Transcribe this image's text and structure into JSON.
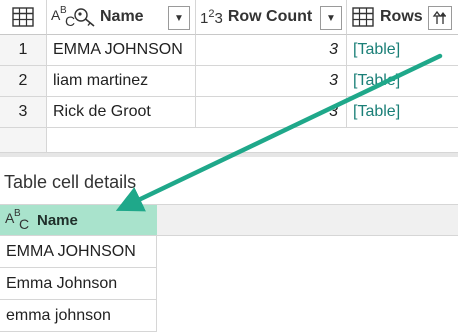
{
  "grid": {
    "columns": [
      {
        "name": "Name",
        "type_icon": "text-type-icon",
        "type_label": "ABC"
      },
      {
        "name": "Row Count",
        "type_icon": "number-type-icon",
        "type_label": "123"
      },
      {
        "name": "Rows",
        "type_icon": "table-type-icon"
      }
    ],
    "rows": [
      {
        "index": "1",
        "name": "EMMA JOHNSON",
        "count": "3",
        "rows": "[Table]"
      },
      {
        "index": "2",
        "name": "liam martinez",
        "count": "3",
        "rows": "[Table]"
      },
      {
        "index": "3",
        "name": "Rick de Groot",
        "count": "3",
        "rows": "[Table]"
      }
    ]
  },
  "details": {
    "title": "Table cell details",
    "column": "Name",
    "values": [
      "EMMA JOHNSON",
      "Emma Johnson",
      "emma johnson"
    ]
  },
  "colors": {
    "highlight": "#a9e3cc",
    "link": "#1a7f77",
    "arrow": "#1fa88a"
  }
}
